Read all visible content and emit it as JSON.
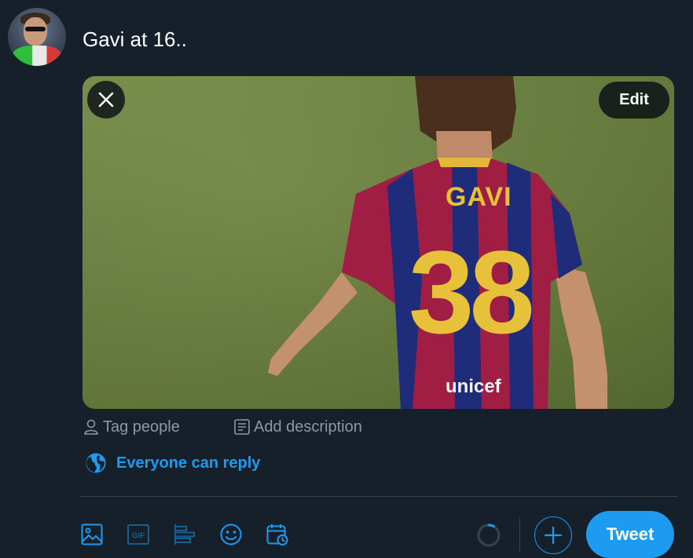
{
  "composer": {
    "text": "Gavi at 16..",
    "avatar_icon": "user-avatar-photo"
  },
  "media": {
    "jersey_name": "GAVI",
    "jersey_number": "38",
    "sponsor": "unicef",
    "edit_label": "Edit",
    "close_icon": "close-icon"
  },
  "media_actions": {
    "tag_label": "Tag people",
    "description_label": "Add description"
  },
  "reply": {
    "label": "Everyone can reply",
    "icon": "globe-icon"
  },
  "toolbar": {
    "icons": [
      "image-icon",
      "gif-icon",
      "poll-icon",
      "emoji-icon",
      "schedule-icon"
    ],
    "gif_label": "GIF",
    "tweet_label": "Tweet",
    "add_icon": "plus-icon",
    "char_progress": 0.08
  },
  "colors": {
    "background": "#15202b",
    "accent": "#1d9bf0",
    "muted": "#8b98a5",
    "divider": "#38444d"
  }
}
